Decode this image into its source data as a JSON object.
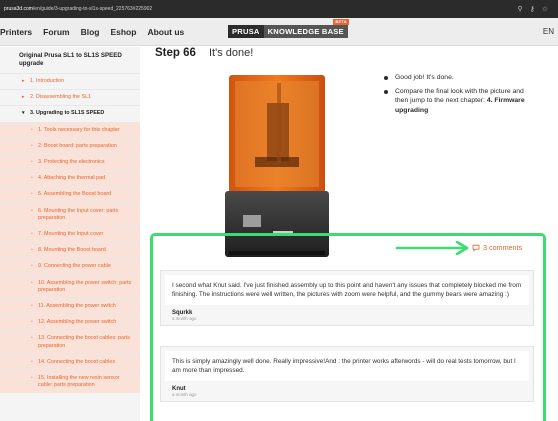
{
  "browser": {
    "url_prefix": "prusa3d.com",
    "url_rest": "/en/guide/3-upgrading-to-sl1s-speed_225763#225902",
    "icons": [
      "search-icon",
      "key-icon",
      "star-icon"
    ]
  },
  "header": {
    "nav": [
      "Printers",
      "Forum",
      "Blog",
      "Eshop",
      "About us"
    ],
    "logo_left": "PRUSA",
    "logo_right": "KNOWLEDGE BASE",
    "logo_badge": "BETA",
    "lang": "EN"
  },
  "sidebar": {
    "guide_title": "Original Prusa SL1 to SL1S SPEED upgrade",
    "items": [
      {
        "label": "1. Introduction",
        "level": "top"
      },
      {
        "label": "2. Disassembling the SL1",
        "level": "top"
      },
      {
        "label": "3. Upgrading to SL1S SPEED",
        "level": "current"
      },
      {
        "label": "1. Tools necessary for this chapter",
        "level": "sub"
      },
      {
        "label": "2. Boost board: parts preparation",
        "level": "sub"
      },
      {
        "label": "3. Protecting the electronics",
        "level": "sub"
      },
      {
        "label": "4. Attaching the thermal pad",
        "level": "sub"
      },
      {
        "label": "5. Assembling the Boost board",
        "level": "sub"
      },
      {
        "label": "6. Mounting the Input cover: parts preparation",
        "level": "sub"
      },
      {
        "label": "7. Mounting the Input cover",
        "level": "sub"
      },
      {
        "label": "8. Mounting the Boost board",
        "level": "sub"
      },
      {
        "label": "9. Connecting the power cable",
        "level": "sub"
      },
      {
        "label": "10. Assembling the power switch: parts preparation",
        "level": "sub"
      },
      {
        "label": "11. Assembling the power switch",
        "level": "sub"
      },
      {
        "label": "12. Assembling the power switch",
        "level": "sub"
      },
      {
        "label": "13. Connecting the boost cables: parts preparation",
        "level": "sub"
      },
      {
        "label": "14. Connecting the boost cables",
        "level": "sub"
      },
      {
        "label": "15. Installing the new resin sensor cable: parts preparation",
        "level": "sub"
      }
    ]
  },
  "step": {
    "number": "Step 66",
    "title": "It's done!",
    "bullets": [
      {
        "text": "Good job! It's done."
      },
      {
        "text": "Compare the final look with the picture and then jump to the next chapter: ",
        "bold": "4. Firmware upgrading"
      }
    ]
  },
  "comments": {
    "count_label": "3 comments",
    "items": [
      {
        "text": "I second what Knut said. I've just finished assembly up to this point and haven't any issues that completely blocked me from finishing. The instructions were well written, the pictures with zoom were helpful, and the gummy bears were amazing :)",
        "author": "Squrkk",
        "time": "a month ago"
      },
      {
        "text": "This is simply amazingly well done. Really impressive!And : the printer works afterwords - will do real tests tomorrow, but I am more than impressed.",
        "author": "Knut",
        "time": "a month ago"
      }
    ]
  },
  "colors": {
    "accent": "#e8642e",
    "highlight": "#3ddc72",
    "sub_item_bg": "#fbe2d8"
  }
}
